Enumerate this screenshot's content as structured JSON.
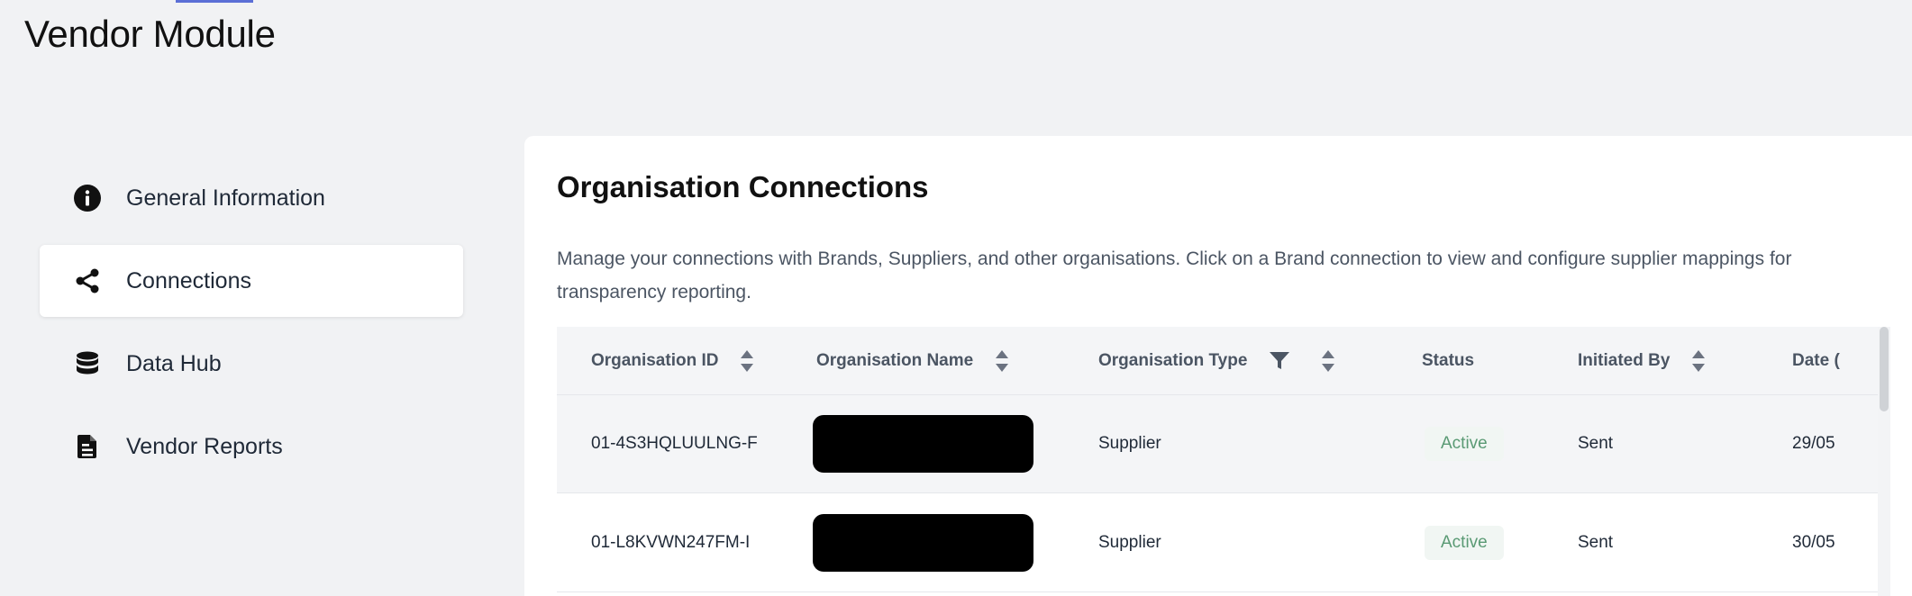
{
  "page": {
    "title": "Vendor Module"
  },
  "sidebar": {
    "items": [
      {
        "label": "General Information",
        "icon": "info-icon",
        "active": false
      },
      {
        "label": "Connections",
        "icon": "share-icon",
        "active": true
      },
      {
        "label": "Data Hub",
        "icon": "database-icon",
        "active": false
      },
      {
        "label": "Vendor Reports",
        "icon": "document-icon",
        "active": false
      }
    ]
  },
  "panel": {
    "title": "Organisation Connections",
    "description": "Manage your connections with Brands, Suppliers, and other organisations. Click on a Brand connection to view and configure supplier mappings for transparency reporting."
  },
  "table": {
    "columns": [
      {
        "label": "Organisation ID",
        "sortable": true
      },
      {
        "label": "Organisation Name",
        "sortable": true
      },
      {
        "label": "Organisation Type",
        "sortable": true,
        "filterable": true
      },
      {
        "label": "Status",
        "sortable": false
      },
      {
        "label": "Initiated By",
        "sortable": true
      },
      {
        "label": "Date (",
        "sortable": false
      }
    ],
    "rows": [
      {
        "id": "01-4S3HQLUULNG-F",
        "name": "",
        "type": "Supplier",
        "status": "Active",
        "initiated_by": "Sent",
        "date": "29/05"
      },
      {
        "id": "01-L8KVWN247FM-I",
        "name": "",
        "type": "Supplier",
        "status": "Active",
        "initiated_by": "Sent",
        "date": "30/05"
      }
    ]
  },
  "colors": {
    "accent": "#5b6fd6",
    "status_active_text": "#5a9a74",
    "status_active_bg": "#f1f6f3"
  }
}
